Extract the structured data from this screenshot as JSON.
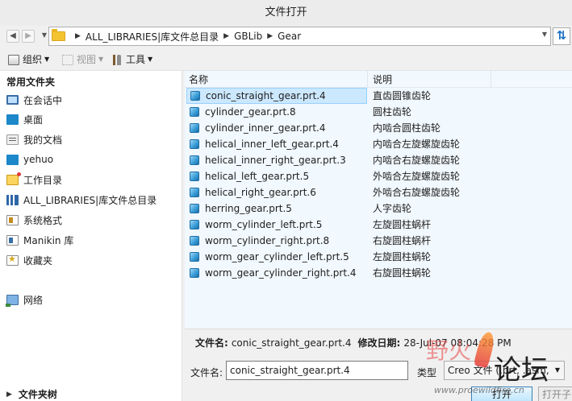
{
  "window": {
    "title": "文件打开"
  },
  "address": {
    "crumbs": [
      "ALL_LIBRARIES|库文件总目录",
      "GBLib",
      "Gear"
    ]
  },
  "toolbar": {
    "organize_label": "组织",
    "view_label": "视图",
    "tools_label": "工具"
  },
  "sidebar": {
    "header": "常用文件夹",
    "items": [
      {
        "label": "在会话中",
        "icon": "monitor-icon"
      },
      {
        "label": "桌面",
        "icon": "desktop-icon"
      },
      {
        "label": "我的文档",
        "icon": "documents-icon"
      },
      {
        "label": "yehuo",
        "icon": "user-folder-icon"
      },
      {
        "label": "工作目录",
        "icon": "working-directory-icon"
      },
      {
        "label": "ALL_LIBRARIES|库文件总目录",
        "icon": "library-icon"
      },
      {
        "label": "系统格式",
        "icon": "system-format-icon"
      },
      {
        "label": "Manikin 库",
        "icon": "manikin-library-icon"
      },
      {
        "label": "收藏夹",
        "icon": "favorites-icon"
      }
    ],
    "network_label": "网络",
    "folder_tree_label": "文件夹树"
  },
  "filelist": {
    "columns": {
      "name": "名称",
      "description": "说明"
    },
    "rows": [
      {
        "name": "conic_straight_gear.prt.4",
        "desc": "直齿圆锥齿轮",
        "selected": true
      },
      {
        "name": "cylinder_gear.prt.8",
        "desc": "圆柱齿轮"
      },
      {
        "name": "cylinder_inner_gear.prt.4",
        "desc": "内啮合圆柱齿轮"
      },
      {
        "name": "helical_inner_left_gear.prt.4",
        "desc": "内啮合左旋螺旋齿轮"
      },
      {
        "name": "helical_inner_right_gear.prt.3",
        "desc": "内啮合右旋螺旋齿轮"
      },
      {
        "name": "helical_left_gear.prt.5",
        "desc": "外啮合左旋螺旋齿轮"
      },
      {
        "name": "helical_right_gear.prt.6",
        "desc": "外啮合右旋螺旋齿轮"
      },
      {
        "name": "herring_gear.prt.5",
        "desc": "人字齿轮"
      },
      {
        "name": "worm_cylinder_left.prt.5",
        "desc": "左旋圆柱蜗杆"
      },
      {
        "name": "worm_cylinder_right.prt.8",
        "desc": "右旋圆柱蜗杆"
      },
      {
        "name": "worm_gear_cylinder_left.prt.5",
        "desc": "左旋圆柱蜗轮"
      },
      {
        "name": "worm_gear_cylinder_right.prt.4",
        "desc": "右旋圆柱蜗轮"
      }
    ]
  },
  "details": {
    "filename_label": "文件名:",
    "filename_value": "conic_straight_gear.prt.4",
    "modified_label": "修改日期:",
    "modified_value": "28-Jul-07 08:04:28 PM"
  },
  "footer": {
    "filename_label": "文件名:",
    "filename_value": "conic_straight_gear.prt.4",
    "type_label": "类型",
    "type_value": "Creo 文件 (.prt, .asm,",
    "open_label": "打开",
    "cancel_label": "打开子"
  },
  "watermark": {
    "logo_text": "野火",
    "forum_text": "论坛",
    "url": "www.proewildfire.cn"
  },
  "colors": {
    "selection": "#cce8ff",
    "list_background": "#f1f8fe",
    "accent": "#1a6fc4"
  }
}
